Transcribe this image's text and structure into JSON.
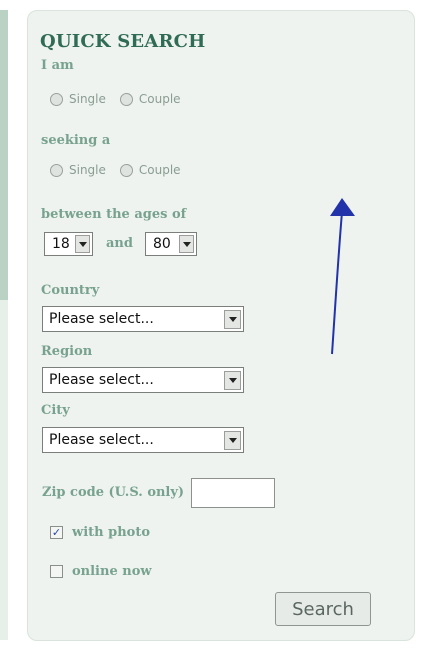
{
  "widget": {
    "title": "QUICK SEARCH",
    "i_am": {
      "label": "I am",
      "options": [
        "Single",
        "Couple"
      ]
    },
    "seeking": {
      "label": "seeking a",
      "options": [
        "Single",
        "Couple"
      ]
    },
    "ages": {
      "label": "between the ages of",
      "min_value": "18",
      "and_label": "and",
      "max_value": "80"
    },
    "country": {
      "label": "Country",
      "selected": "Please select..."
    },
    "region": {
      "label": "Region",
      "selected": "Please select..."
    },
    "city": {
      "label": "City",
      "selected": "Please select..."
    },
    "zip": {
      "label": "Zip code (U.S. only)",
      "value": ""
    },
    "with_photo": {
      "label": "with photo",
      "checked": true
    },
    "online_now": {
      "label": "online now",
      "checked": false
    },
    "search_button": "Search"
  },
  "annotation": {
    "color": "#2233aa"
  }
}
